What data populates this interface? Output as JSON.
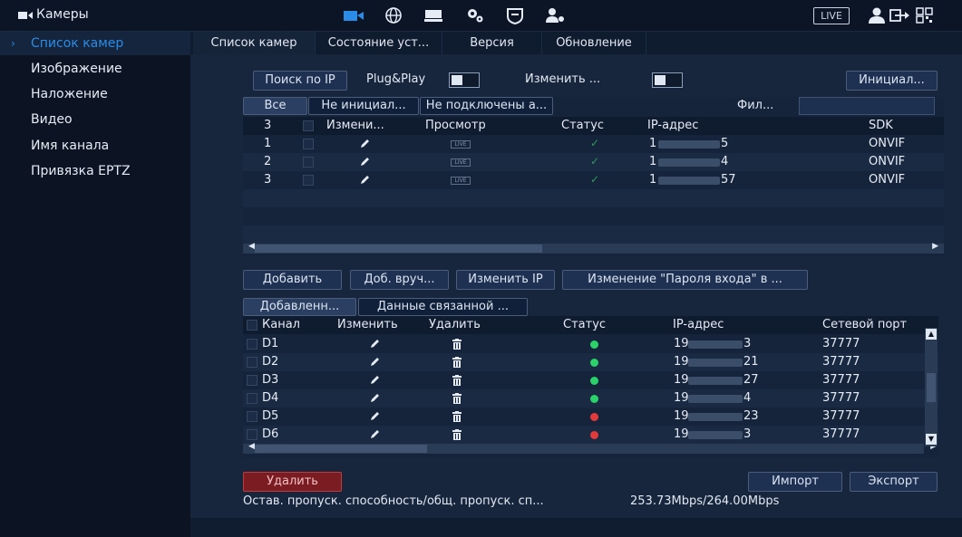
{
  "window": {
    "title": "Камеры"
  },
  "topbar": {
    "live_label": "LIVE",
    "icons": [
      "camera-icon",
      "network-icon",
      "storage-icon",
      "settings-icon",
      "security-icon",
      "account-icon",
      "user-icon",
      "logout-icon",
      "qr-code-icon"
    ]
  },
  "sidebar": {
    "items": [
      {
        "label": "Список камер",
        "active": true
      },
      {
        "label": "Изображение"
      },
      {
        "label": "Наложение"
      },
      {
        "label": "Видео"
      },
      {
        "label": "Имя канала"
      },
      {
        "label": "Привязка EPTZ"
      }
    ]
  },
  "tabs": [
    {
      "label": "Список камер",
      "active": true
    },
    {
      "label": "Состояние уст..."
    },
    {
      "label": "Версия"
    },
    {
      "label": "Обновление"
    }
  ],
  "toolbar": {
    "search_ip": "Поиск по IP",
    "plug_play": "Plug&Play",
    "change": "Изменить ...",
    "init": "Инициал..."
  },
  "filter": {
    "tabs": [
      "Все",
      "Не инициал...",
      "Не подключены а..."
    ],
    "filter_label": "Фил...",
    "filter_value": ""
  },
  "found_table": {
    "count": "3",
    "headers": [
      "Измени...",
      "Просмотр",
      "Статус",
      "IP-адрес",
      "SDK"
    ],
    "rows": [
      {
        "num": "1",
        "ip_head": "1",
        "ip_tail": "5",
        "sdk": "ONVIF",
        "view": "LIVE"
      },
      {
        "num": "2",
        "ip_head": "1",
        "ip_tail": "4",
        "sdk": "ONVIF",
        "view": "LIVE"
      },
      {
        "num": "3",
        "ip_head": "1",
        "ip_tail": "57",
        "sdk": "ONVIF",
        "view": "LIVE"
      }
    ]
  },
  "actions": {
    "add": "Добавить",
    "add_manual": "Доб. вруч...",
    "change_ip": "Изменить IP",
    "change_pwd": "Изменение \"Пароля входа\" в ..."
  },
  "added_tabs": [
    "Добавленн...",
    "Данные связанной ..."
  ],
  "added_table": {
    "headers": [
      "Канал",
      "Изменить",
      "Удалить",
      "Статус",
      "IP-адрес",
      "Сетевой порт"
    ],
    "rows": [
      {
        "channel": "D1",
        "status": "online",
        "ip_head": "19",
        "ip_tail": "3",
        "port": "37777"
      },
      {
        "channel": "D2",
        "status": "online",
        "ip_head": "19",
        "ip_tail": "21",
        "port": "37777"
      },
      {
        "channel": "D3",
        "status": "online",
        "ip_head": "19",
        "ip_tail": "27",
        "port": "37777"
      },
      {
        "channel": "D4",
        "status": "online",
        "ip_head": "19",
        "ip_tail": "4",
        "port": "37777"
      },
      {
        "channel": "D5",
        "status": "offline",
        "ip_head": "19",
        "ip_tail": "23",
        "port": "37777"
      },
      {
        "channel": "D6",
        "status": "offline",
        "ip_head": "19",
        "ip_tail": "3",
        "port": "37777"
      }
    ]
  },
  "footer": {
    "delete": "Удалить",
    "import": "Импорт",
    "export": "Экспорт",
    "bandwidth_label": "Остав. пропуск. способность/общ. пропуск. сп...",
    "bandwidth_value": "253.73Mbps/264.00Mbps"
  },
  "colors": {
    "accent": "#2a8ce6",
    "online": "#2bd26a",
    "offline": "#e23a3a",
    "check": "#2a9a58"
  }
}
